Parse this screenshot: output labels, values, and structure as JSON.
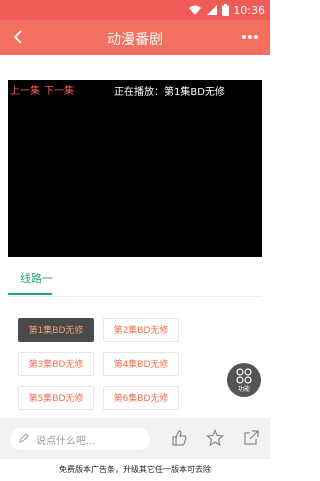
{
  "status": {
    "time": "10:36"
  },
  "appbar": {
    "title": "动漫番剧"
  },
  "player": {
    "prev_label": "上一集",
    "next_label": "下一集",
    "playing_prefix": "正在播放：",
    "playing_title": "第1集BD无修"
  },
  "tabs": {
    "items": [
      {
        "label": "线路一"
      }
    ]
  },
  "episodes": [
    {
      "label": "第1集BD无修",
      "active": true
    },
    {
      "label": "第2集BD无修",
      "active": false
    },
    {
      "label": "第3集BD无修",
      "active": false
    },
    {
      "label": "第4集BD无修",
      "active": false
    },
    {
      "label": "第5集BD无修",
      "active": false
    },
    {
      "label": "第6集BD无修",
      "active": false
    }
  ],
  "function_button": {
    "label": "功能"
  },
  "comment": {
    "placeholder": "说点什么吧..."
  },
  "ad": {
    "text": "免费版本广告条，升级其它任一版本可去除"
  },
  "colors": {
    "accent": "#f36f5f",
    "tab": "#2aa57a",
    "episode_text": "#f26f4b"
  },
  "icons": [
    "wifi-icon",
    "signal-icon",
    "battery-icon",
    "back-arrow-icon",
    "more-icon",
    "grid-icon",
    "edit-icon",
    "like-icon",
    "star-icon",
    "share-icon"
  ]
}
